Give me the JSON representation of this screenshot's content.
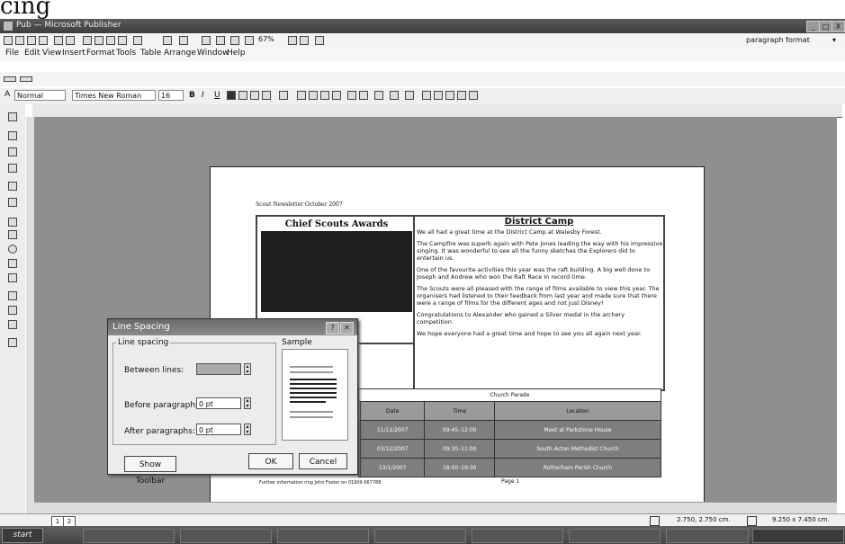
{
  "page_fragment": "cing",
  "window": {
    "title": "Pub — Microsoft Publisher",
    "controls": [
      "_",
      "□",
      "X"
    ]
  },
  "menu": [
    "File",
    "Edit",
    "View",
    "Insert",
    "Format",
    "Tools",
    "Table",
    "Arrange",
    "Window",
    "Help"
  ],
  "toolbar": {
    "zoom": "67%",
    "help_box": "paragraph format"
  },
  "format_bar": {
    "style": "Normal",
    "font": "Times New Roman",
    "size": "16",
    "bold": "B",
    "italic": "I",
    "underline": "U"
  },
  "document": {
    "newsletter_header": "Scout Newsletter October 2007",
    "left_title": "Chief Scouts Awards",
    "right_title": "District Camp",
    "paragraphs": [
      "We all had a great time at the District Camp at Walesby Forest.",
      "The Campfire was superb again with Pete Jones leading the way with his impressive singing. It was wonderful to see all the funny sketches the Explorers did to entertain us.",
      "One of the favourite activities this year was the raft building. A big well done to Joseph and Andrew who won the Raft Race in record time.",
      "The Scouts were all pleased with the range of films available to view this year. The organisers had listened to their feedback from last year and made sure that there were a range of films for the different ages and not just Disney!",
      "Congratulations to Alexander who gained a Silver medal in the archery competition.",
      "We hope everyone had a great time and hope to see you all again next year."
    ],
    "table": {
      "caption": "Church Parade",
      "headers": [
        "",
        "Date",
        "Time",
        "Location"
      ],
      "rows": [
        [
          "",
          "11/11/2007",
          "09:45–12:00",
          "Meet at Parkstone House"
        ],
        [
          "",
          "03/12/2007",
          "09:30–11:00",
          "South Acton Methodist Church"
        ],
        [
          "",
          "13/1/2007",
          "18:00–19:30",
          "Rotherham Parish Church"
        ]
      ]
    },
    "footer": "Further information ring John Foster on 01909 667788",
    "footer_page": "Page 1"
  },
  "dialog": {
    "title": "Line Spacing",
    "group_label": "Line spacing",
    "sample_label": "Sample",
    "between_label": "Between lines:",
    "between_value": "",
    "before_label": "Before paragraphs:",
    "before_value": "0 pt",
    "after_label": "After paragraphs:",
    "after_value": "0 pt",
    "show_toolbar": "Show Toolbar",
    "ok": "OK",
    "cancel": "Cancel"
  },
  "status": {
    "position": "2.750, 2.750 cm.",
    "size": "9.250 x 7.450 cm.",
    "pages": [
      "1",
      "2"
    ]
  },
  "taskbar": {
    "start": "start"
  }
}
